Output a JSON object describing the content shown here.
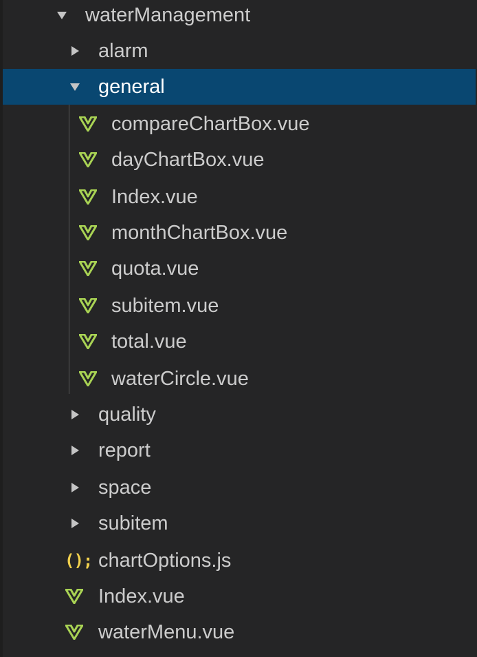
{
  "tree": {
    "root": {
      "label": "waterManagement",
      "icon": "chevron-down-icon"
    },
    "folders_before": [
      {
        "label": "alarm",
        "icon": "chevron-right-icon"
      }
    ],
    "open_folder": {
      "label": "general",
      "icon": "chevron-down-icon",
      "selected": true
    },
    "open_folder_files": [
      {
        "label": "compareChartBox.vue",
        "icon": "vue-file-icon"
      },
      {
        "label": "dayChartBox.vue",
        "icon": "vue-file-icon"
      },
      {
        "label": "Index.vue",
        "icon": "vue-file-icon"
      },
      {
        "label": "monthChartBox.vue",
        "icon": "vue-file-icon"
      },
      {
        "label": "quota.vue",
        "icon": "vue-file-icon"
      },
      {
        "label": "subitem.vue",
        "icon": "vue-file-icon"
      },
      {
        "label": "total.vue",
        "icon": "vue-file-icon"
      },
      {
        "label": "waterCircle.vue",
        "icon": "vue-file-icon"
      }
    ],
    "folders_after": [
      {
        "label": "quality",
        "icon": "chevron-right-icon"
      },
      {
        "label": "report",
        "icon": "chevron-right-icon"
      },
      {
        "label": "space",
        "icon": "chevron-right-icon"
      },
      {
        "label": "subitem",
        "icon": "chevron-right-icon"
      }
    ],
    "root_files": [
      {
        "label": "chartOptions.js",
        "icon": "js-file-icon",
        "glyph": "();"
      },
      {
        "label": "Index.vue",
        "icon": "vue-file-icon"
      },
      {
        "label": "waterMenu.vue",
        "icon": "vue-file-icon"
      }
    ]
  },
  "colors": {
    "background": "#252526",
    "selection": "#094771",
    "text": "#cccccc",
    "vue_icon": "#a9d354",
    "js_icon": "#f1d04d",
    "twisty": "#c5c5c5"
  }
}
